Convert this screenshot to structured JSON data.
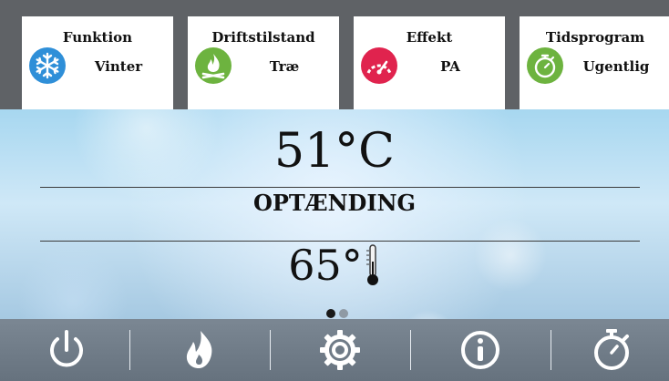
{
  "colors": {
    "snow": "#2f8fd8",
    "fire": "#6db33f",
    "gauge": "#e0234e",
    "timer": "#6db33f",
    "text": "#111111"
  },
  "cards": [
    {
      "title": "Funktion",
      "value": "Vinter",
      "icon": "snowflake-icon"
    },
    {
      "title": "Driftstilstand",
      "value": "Træ",
      "icon": "campfire-icon"
    },
    {
      "title": "Effekt",
      "value": "PA",
      "icon": "gauge-icon"
    },
    {
      "title": "Tidsprogram",
      "value": "Ugentlig",
      "icon": "stopwatch-icon"
    }
  ],
  "main": {
    "current_temp": "51°C",
    "status": "OPTÆNDING",
    "set_temp": "65°",
    "page_count": 2,
    "active_page": 1
  },
  "toolbar": [
    {
      "icon": "power-icon"
    },
    {
      "icon": "flame-icon"
    },
    {
      "icon": "settings-gear-icon"
    },
    {
      "icon": "info-icon"
    },
    {
      "icon": "stopwatch-icon"
    }
  ]
}
